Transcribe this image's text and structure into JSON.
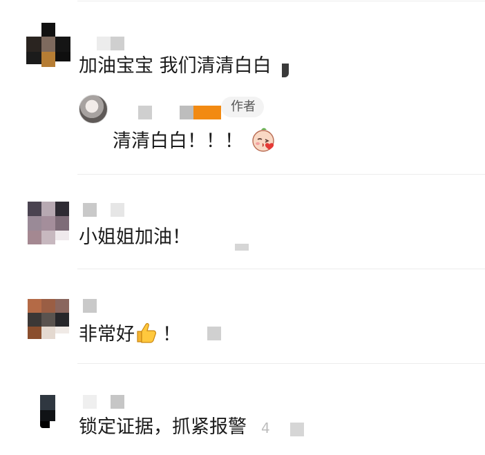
{
  "comments": [
    {
      "text": "加油宝宝 我们清清白白"
    },
    {
      "text": "小姐姐加油！"
    },
    {
      "text": "非常好",
      "suffix": "！"
    },
    {
      "text": "锁定证据，抓紧报警",
      "trailing": "4"
    }
  ],
  "reply": {
    "badge": "作者",
    "text": "清清白白！！！"
  },
  "icons": {
    "reply_emoji": "kiss-face-icon",
    "thumb_emoji": "thumbs-up-icon"
  },
  "colors": {
    "divider": "#ececec",
    "badge_bg": "#f3f3f3",
    "orange_mosaic": "#f28a12"
  }
}
